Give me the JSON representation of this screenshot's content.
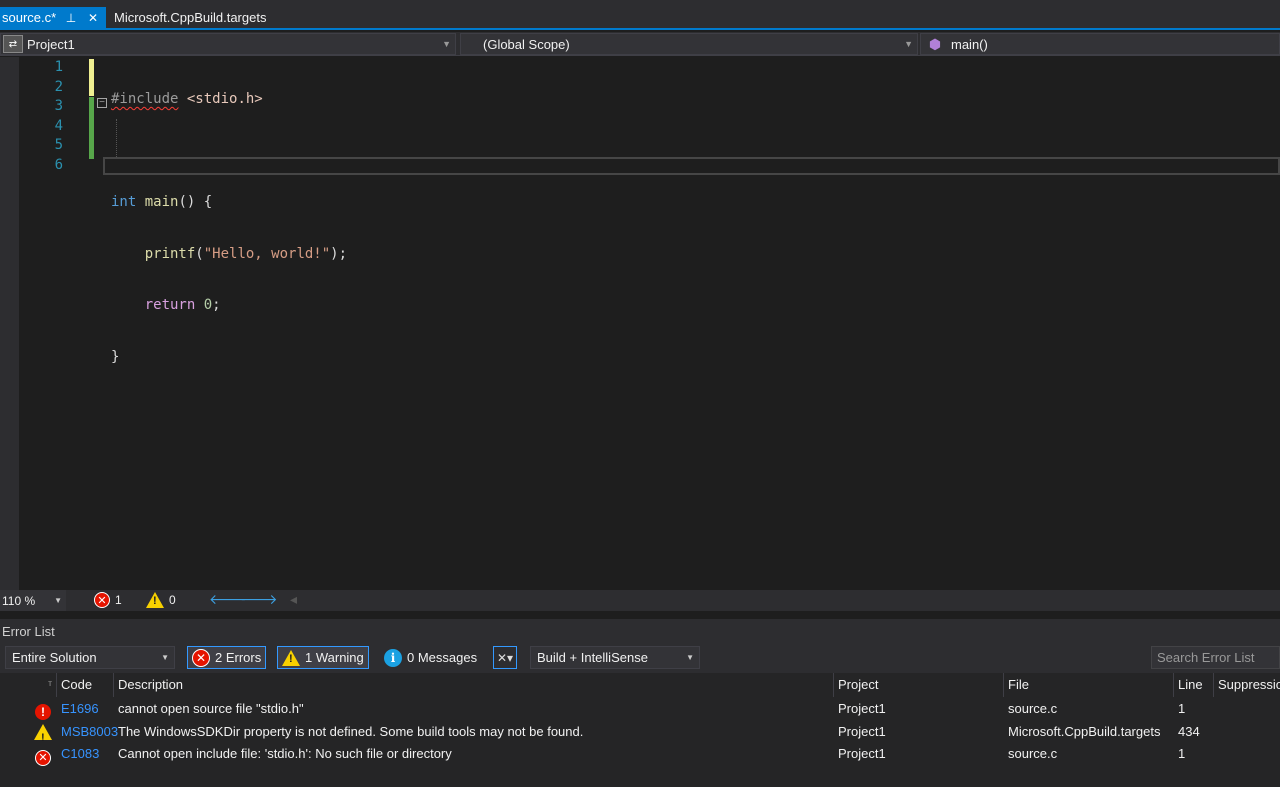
{
  "tabs": [
    {
      "label": "source.c*",
      "active": true
    },
    {
      "label": "Microsoft.CppBuild.targets",
      "active": false
    }
  ],
  "tab_icons": {
    "pin": "📌",
    "close": "✕"
  },
  "navbar": {
    "project": "Project1",
    "scope": "(Global Scope)",
    "member": "main()"
  },
  "editor": {
    "line_numbers": [
      "1",
      "2",
      "3",
      "4",
      "5",
      "6"
    ],
    "lines": {
      "l1_pp": "#include",
      "l1_file": "<stdio.h>",
      "l3_kw": "int",
      "l3_fn": "main",
      "l3_rest": "() {",
      "l4_fn": "printf",
      "l4_open": "(",
      "l4_str": "\"Hello, world!\"",
      "l4_close": ");",
      "l5_kw": "return",
      "l5_num": "0",
      "l5_end": ";",
      "l6": "}"
    }
  },
  "editor_status": {
    "zoom": "110 %",
    "errors": "1",
    "warnings": "0"
  },
  "error_list": {
    "title": "Error List",
    "scope": "Entire Solution",
    "errors_btn": "2 Errors",
    "warnings_btn": "1 Warning",
    "messages_btn": "0 Messages",
    "source_filter": "Build + IntelliSense",
    "search_placeholder": "Search Error List",
    "columns": {
      "code": "Code",
      "description": "Description",
      "project": "Project",
      "file": "File",
      "line": "Line",
      "suppression": "Suppression State"
    },
    "rows": [
      {
        "severity": "intellisense-error",
        "code": "E1696",
        "description": "cannot open source file \"stdio.h\"",
        "project": "Project1",
        "file": "source.c",
        "line": "1"
      },
      {
        "severity": "warning",
        "code": "MSB8003",
        "description": "The WindowsSDKDir property is not defined. Some build tools may not be found.",
        "project": "Project1",
        "file": "Microsoft.CppBuild.targets",
        "line": "434"
      },
      {
        "severity": "error",
        "code": "C1083",
        "description": "Cannot open include file: 'stdio.h': No such file or directory",
        "project": "Project1",
        "file": "source.c",
        "line": "1"
      }
    ]
  },
  "colors": {
    "accent": "#007acc",
    "error": "#e51400",
    "warning": "#f8d100",
    "info": "#1ba1e2",
    "link": "#3794ff"
  }
}
